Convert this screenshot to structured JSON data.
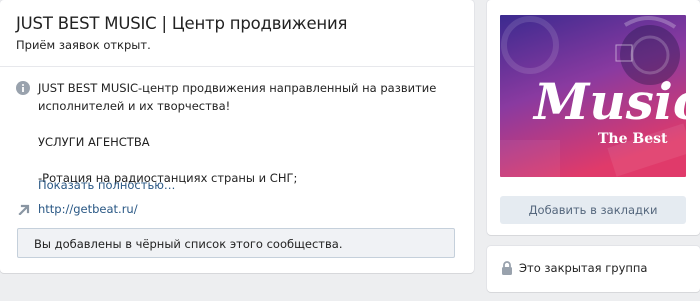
{
  "group": {
    "title": "JUST BEST MUSIC | Центр продвижения",
    "status": "Приём заявок открыт."
  },
  "description": {
    "lines": [
      "JUST BEST MUSIC-центр продвижения направленный на развитие",
      "исполнителей и их творчества!",
      "",
      "УСЛУГИ АГЕНСТВА",
      "",
      "-Ротация на радиостанциях страны и СНГ;"
    ],
    "show_more": "Показать полностью…"
  },
  "website": {
    "url": "http://getbeat.ru/"
  },
  "notice": {
    "text": "Вы добавлены в чёрный список этого сообщества."
  },
  "cover": {
    "word": "Music",
    "tagline": "The Best",
    "colors": {
      "top": "#3b2a8f",
      "middle": "#8a3aa0",
      "bottom": "#e03a6a"
    }
  },
  "sidebar": {
    "bookmark_label": "Добавить в закладки",
    "closed_label": "Это закрытая группа"
  },
  "icons": {
    "info": "info-icon",
    "link": "link-arrow-icon",
    "lock": "lock-icon"
  },
  "colors": {
    "link": "#2a5885",
    "background": "#edeef0",
    "button_bg": "#e5ebf1",
    "button_text": "#55677d"
  }
}
